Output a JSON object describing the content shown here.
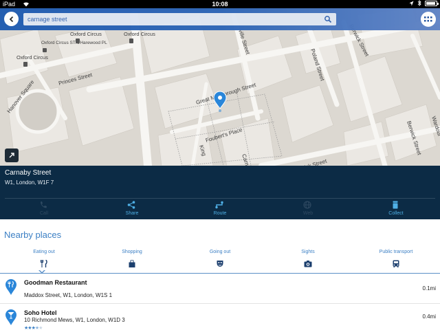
{
  "status_bar": {
    "device": "iPad",
    "time": "10:08"
  },
  "search": {
    "value": "carnage street"
  },
  "map": {
    "street_labels": [
      "Great Marlborough Street",
      "Foubert's Place",
      "Princes Street",
      "Hanover Square",
      "Poland Street",
      "Broadwick Street",
      "Berwick Street",
      "Carnaby",
      "Wardour",
      "Berwick Street",
      "King",
      "ville Street"
    ],
    "tube_stations": [
      "Oxford Circus",
      "Oxford Circus",
      "Oxford Circus"
    ],
    "bus_stop_label": "Oxford Circus STN/Harewood PL"
  },
  "place": {
    "name": "Carnaby Street",
    "address": "W1, London, W1F 7"
  },
  "actions": [
    {
      "label": "Call",
      "enabled": false,
      "icon": "phone-icon"
    },
    {
      "label": "Share",
      "enabled": true,
      "icon": "share-icon"
    },
    {
      "label": "Route",
      "enabled": true,
      "icon": "route-icon"
    },
    {
      "label": "Web",
      "enabled": false,
      "icon": "globe-icon"
    },
    {
      "label": "Collect",
      "enabled": true,
      "icon": "collect-icon"
    }
  ],
  "nearby": {
    "title": "Nearby places",
    "categories": [
      {
        "label": "Eating out",
        "icon": "fork-knife-icon",
        "selected": true
      },
      {
        "label": "Shopping",
        "icon": "shopping-bag-icon",
        "selected": false
      },
      {
        "label": "Going out",
        "icon": "mask-icon",
        "selected": false
      },
      {
        "label": "Sights",
        "icon": "camera-icon",
        "selected": false
      },
      {
        "label": "Public transport",
        "icon": "bus-icon",
        "selected": false
      }
    ],
    "places": [
      {
        "name": "Goodman Restaurant",
        "address": "Maddox Street, W1, London, W1S 1",
        "distance": "0.1mi",
        "rating": null
      },
      {
        "name": "Soho Hotel",
        "address": "10 Richmond Mews, W1, London, W1D 3",
        "distance": "0.4mi",
        "rating": 3.5
      }
    ]
  },
  "colors": {
    "accent": "#3b7fc4",
    "panel": "#0c2b45",
    "header": "#2c64b6",
    "link": "#4fb0e6"
  }
}
